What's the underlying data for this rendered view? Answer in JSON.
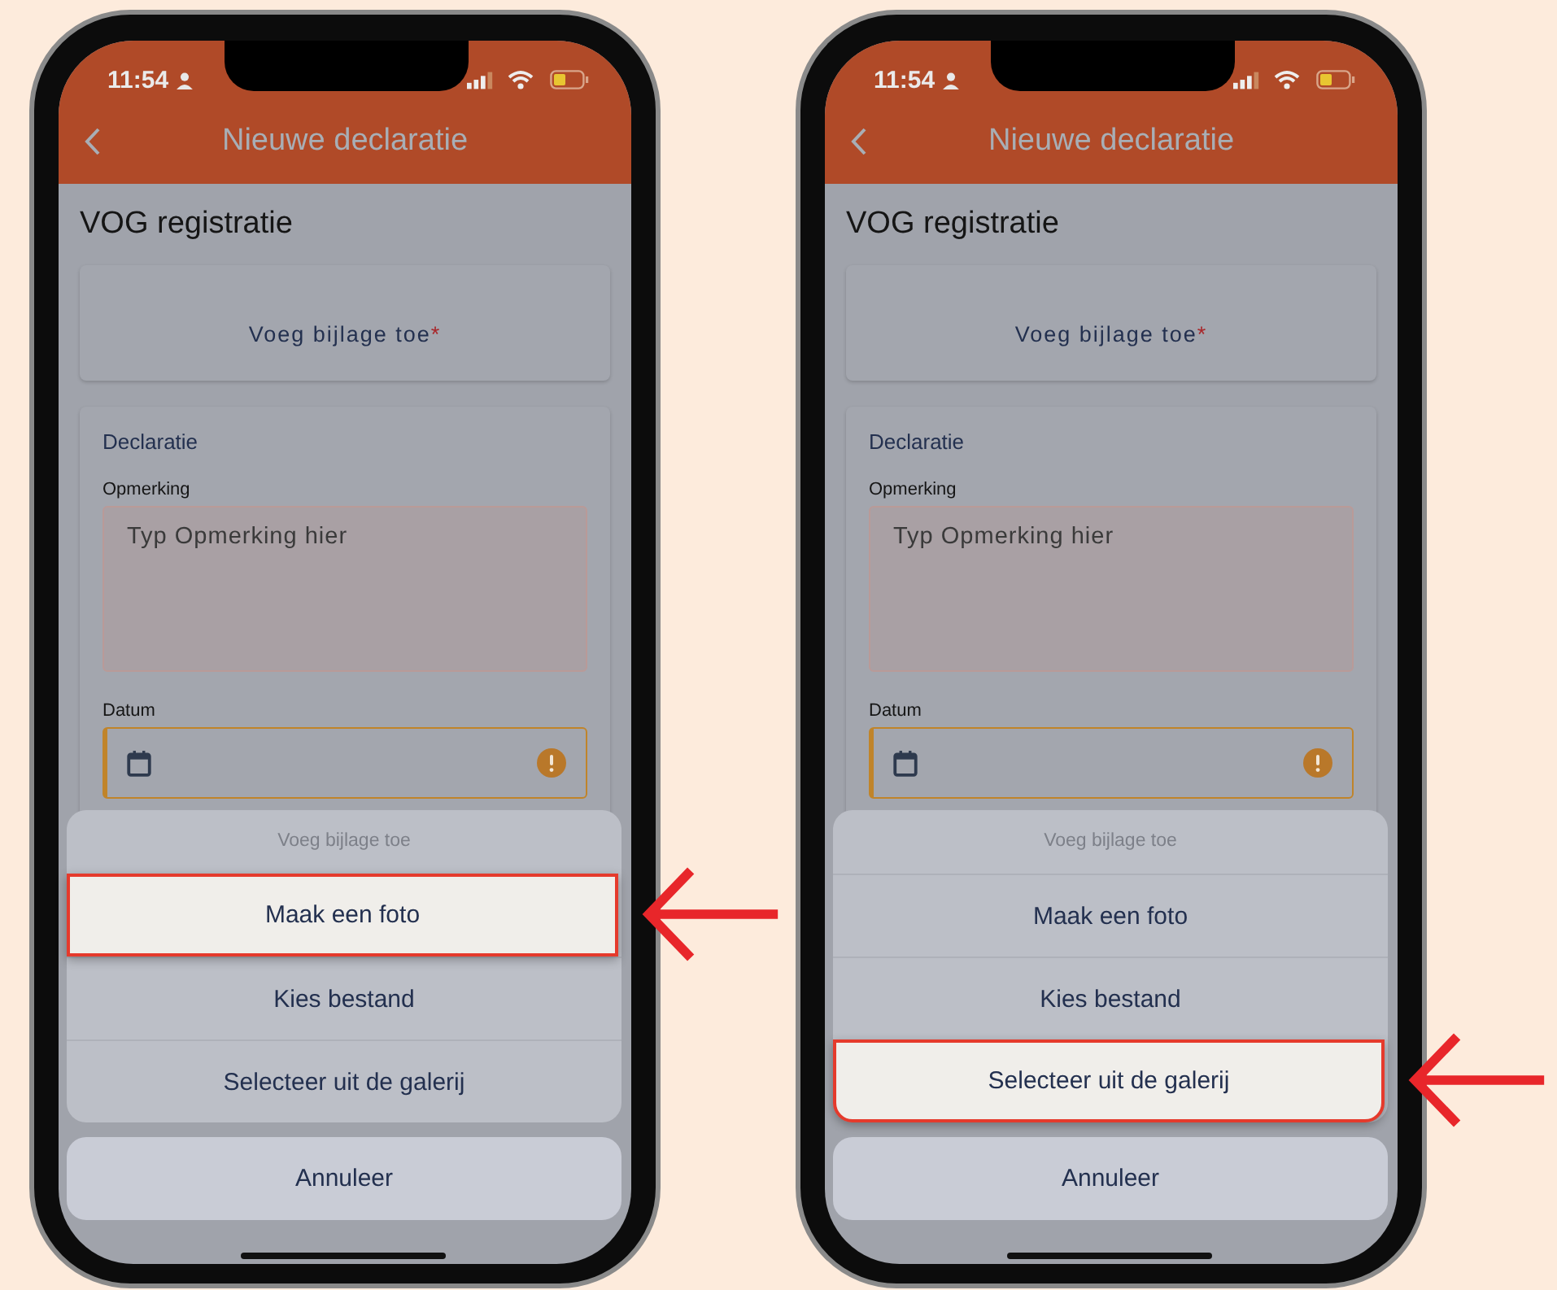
{
  "phones": [
    {
      "status_time": "11:54",
      "header_title": "Nieuwe declaratie",
      "section_title": "VOG registratie",
      "attach_label": "Voeg bijlage toe",
      "required_mark": "*",
      "card_title": "Declaratie",
      "remark_label": "Opmerking",
      "remark_placeholder": "Typ Opmerking hier",
      "date_label": "Datum",
      "sheet_title": "Voeg bijlage toe",
      "actions": [
        {
          "label": "Maak een foto",
          "selected": true
        },
        {
          "label": "Kies bestand",
          "selected": false
        },
        {
          "label": "Selecteer uit de galerij",
          "selected": false
        }
      ],
      "cancel": "Annuleer"
    },
    {
      "status_time": "11:54",
      "header_title": "Nieuwe declaratie",
      "section_title": "VOG registratie",
      "attach_label": "Voeg bijlage toe",
      "required_mark": "*",
      "card_title": "Declaratie",
      "remark_label": "Opmerking",
      "remark_placeholder": "Typ Opmerking hier",
      "date_label": "Datum",
      "sheet_title": "Voeg bijlage toe",
      "actions": [
        {
          "label": "Maak een foto",
          "selected": false
        },
        {
          "label": "Kies bestand",
          "selected": false
        },
        {
          "label": "Selecteer uit de galerij",
          "selected": true
        }
      ],
      "cancel": "Annuleer"
    }
  ]
}
